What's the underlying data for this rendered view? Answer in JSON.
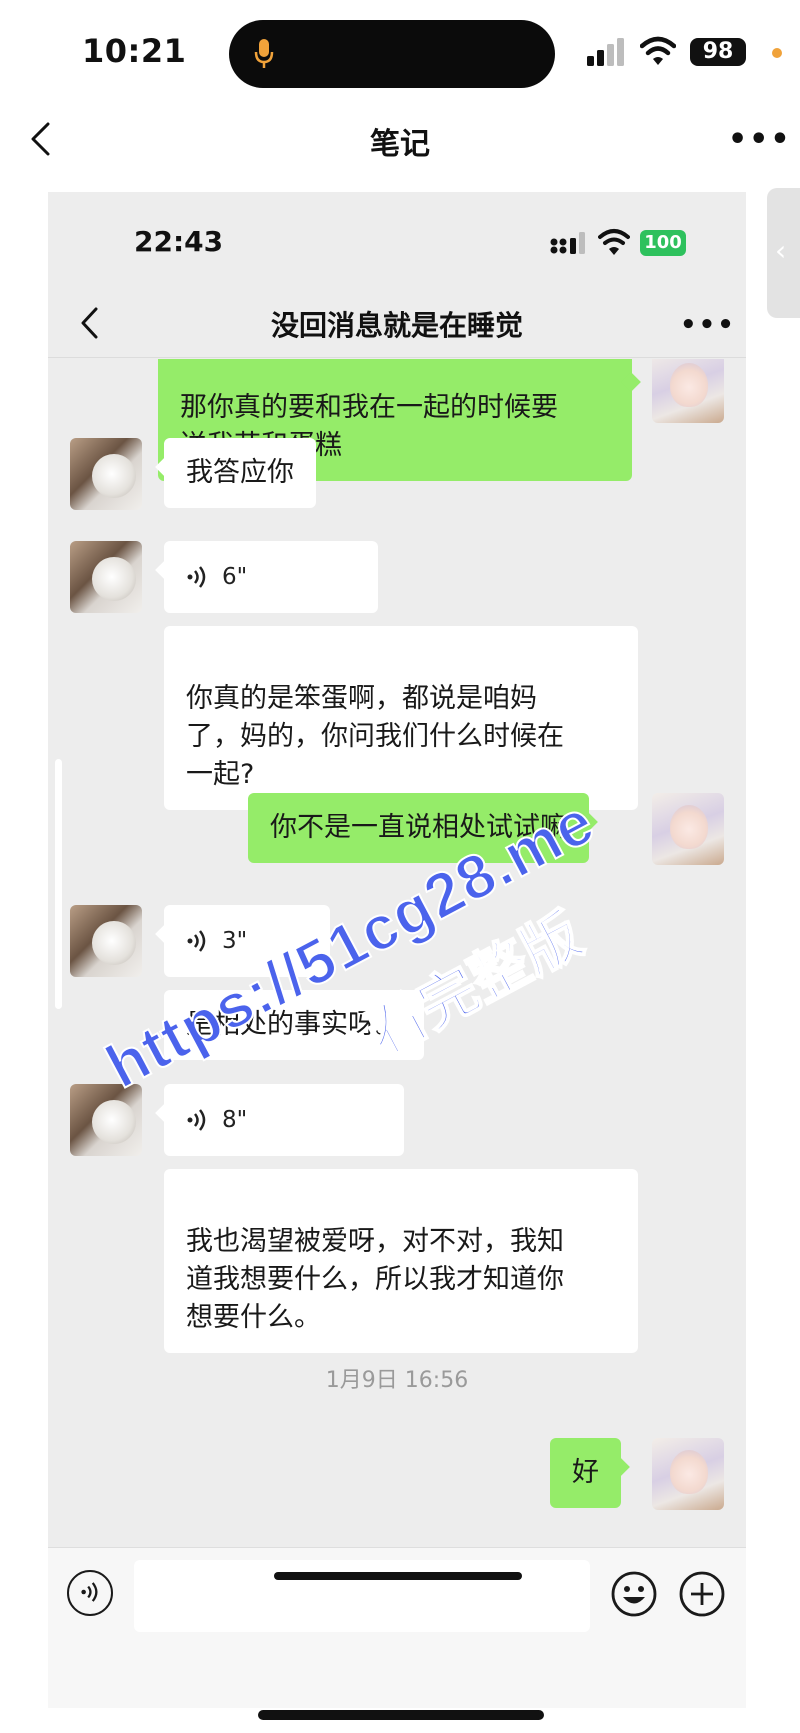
{
  "outer": {
    "time": "10:21",
    "battery": "98",
    "nav_title": "笔记",
    "more": "•••"
  },
  "inner": {
    "time": "22:43",
    "battery": "100",
    "nav_title": "没回消息就是在睡觉",
    "more": "•••"
  },
  "messages": [
    {
      "side": "me",
      "type": "text",
      "text": "那你真的要和我在一起的时候要\n送我花和蛋糕"
    },
    {
      "side": "in",
      "type": "text",
      "text": "我答应你"
    },
    {
      "side": "in",
      "type": "voice",
      "text": "6\""
    },
    {
      "side": "in",
      "type": "text",
      "text": "你真的是笨蛋啊，都说是咱妈\n了，妈的，你问我们什么时候在\n一起?"
    },
    {
      "side": "me",
      "type": "text",
      "text": "你不是一直说相处试试嘛"
    },
    {
      "side": "in",
      "type": "voice",
      "text": "3\""
    },
    {
      "side": "in",
      "type": "text",
      "text": "是相处的事实呀。"
    },
    {
      "side": "in",
      "type": "voice",
      "text": "8\""
    },
    {
      "side": "in",
      "type": "text",
      "text": "我也渴望被爱呀，对不对，我知\n道我想要什么，所以我才知道你\n想要什么。"
    },
    {
      "side": "me",
      "type": "text",
      "text": "好"
    }
  ],
  "timestamp": "1月9日 16:56",
  "watermark": {
    "line1": "https://51cg28.me",
    "line2": "看完整版"
  },
  "icons": [
    "microphone-icon",
    "signal-icon",
    "wifi-icon",
    "back-chevron-icon",
    "more-icon",
    "voice-wave-icon",
    "emoji-icon",
    "plus-icon"
  ]
}
